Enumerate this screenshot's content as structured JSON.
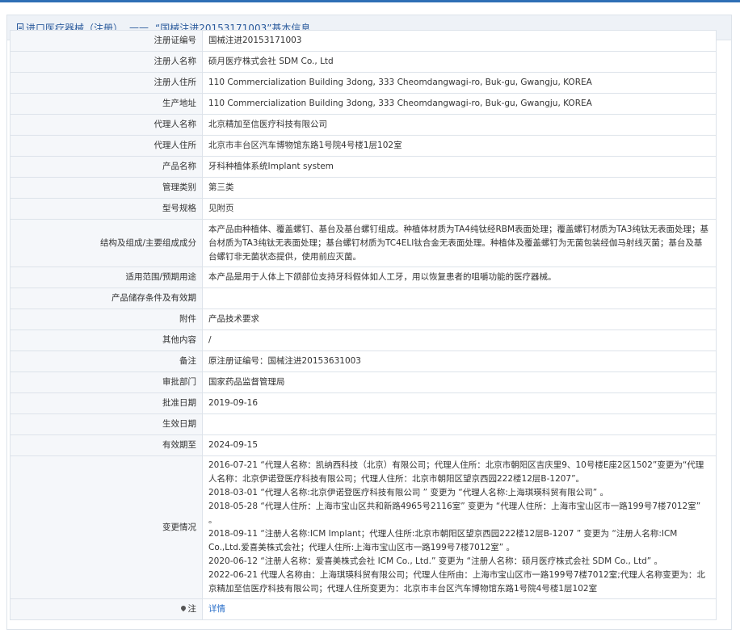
{
  "header": {
    "category": "进口医疗器械（注册）",
    "separator": "——",
    "subject": "“国械注进20153171003”基本信息"
  },
  "rows": [
    {
      "label": "注册证编号",
      "value": "国械注进20153171003"
    },
    {
      "label": "注册人名称",
      "value": "硕月医疗株式会社 SDM Co., Ltd"
    },
    {
      "label": "注册人住所",
      "value": "110 Commercialization Building 3dong, 333 Cheomdangwagi-ro, Buk-gu, Gwangju, KOREA"
    },
    {
      "label": "生产地址",
      "value": "110 Commercialization Building 3dong, 333 Cheomdangwagi-ro, Buk-gu, Gwangju, KOREA"
    },
    {
      "label": "代理人名称",
      "value": "北京精加至信医疗科技有限公司"
    },
    {
      "label": "代理人住所",
      "value": "北京市丰台区汽车博物馆东路1号院4号楼1层102室"
    },
    {
      "label": "产品名称",
      "value": "牙科种植体系统Implant system"
    },
    {
      "label": "管理类别",
      "value": "第三类"
    },
    {
      "label": "型号规格",
      "value": "见附页"
    },
    {
      "label": "结构及组成/主要组成成分",
      "value": "本产品由种植体、覆盖螺钉、基台及基台螺钉组成。种植体材质为TA4纯钛经RBM表面处理；覆盖螺钉材质为TA3纯钛无表面处理；基台材质为TA3纯钛无表面处理；基台螺钉材质为TC4ELI钛合金无表面处理。种植体及覆盖螺钉为无菌包装经伽马射线灭菌；基台及基台螺钉非无菌状态提供，使用前应灭菌。"
    },
    {
      "label": "适用范围/预期用途",
      "value": "本产品是用于人体上下颌部位支持牙科假体如人工牙，用以恢复患者的咀嚼功能的医疗器械。"
    },
    {
      "label": "产品储存条件及有效期",
      "value": ""
    },
    {
      "label": "附件",
      "value": "产品技术要求"
    },
    {
      "label": "其他内容",
      "value": "/"
    },
    {
      "label": "备注",
      "value": "原注册证编号：国械注进20153631003"
    },
    {
      "label": "审批部门",
      "value": "国家药品监督管理局"
    },
    {
      "label": "批准日期",
      "value": "2019-09-16"
    },
    {
      "label": "生效日期",
      "value": ""
    },
    {
      "label": "有效期至",
      "value": "2024-09-15"
    }
  ],
  "changes": {
    "label": "变更情况",
    "lines": [
      "2016-07-21 “代理人名称：凯纳西科技（北京）有限公司；代理人住所：北京市朝阳区吉庆里9、10号楼E座2区1502”变更为“代理人名称：北京伊诺登医疗科技有限公司；代理人住所：北京市朝阳区望京西园222楼12层B-1207”。",
      "2018-03-01 “代理人名称:北京伊诺登医疗科技有限公司 ” 变更为 “代理人名称:上海琪瑛科贸有限公司” 。",
      "2018-05-28 “代理人住所：上海市宝山区共和新路4965号2116室” 变更为 “代理人住所：上海市宝山区市一路199号7楼7012室” 。",
      "2018-09-11 “注册人名称:ICM Implant；代理人住所:北京市朝阳区望京西园222楼12层B-1207 ” 变更为 “注册人名称:ICM Co.,Ltd.爱喜美株式会社；代理人住所:上海市宝山区市一路199号7楼7012室” 。",
      "2020-06-12 “注册人名称：爱喜美株式会社 ICM Co., Ltd.” 变更为 “注册人名称：硕月医疗株式会社 SDM Co., Ltd” 。",
      "2022-06-21 代理人名称由：上海琪瑛科贸有限公司；代理人住所由：上海市宝山区市一路199号7楼7012室;代理人名称变更为：北京精加至信医疗科技有限公司；代理人住所变更为：北京市丰台区汽车博物馆东路1号院4号楼1层102室"
    ]
  },
  "note": {
    "label": "注",
    "link": "详情",
    "icon": "pin-icon"
  }
}
